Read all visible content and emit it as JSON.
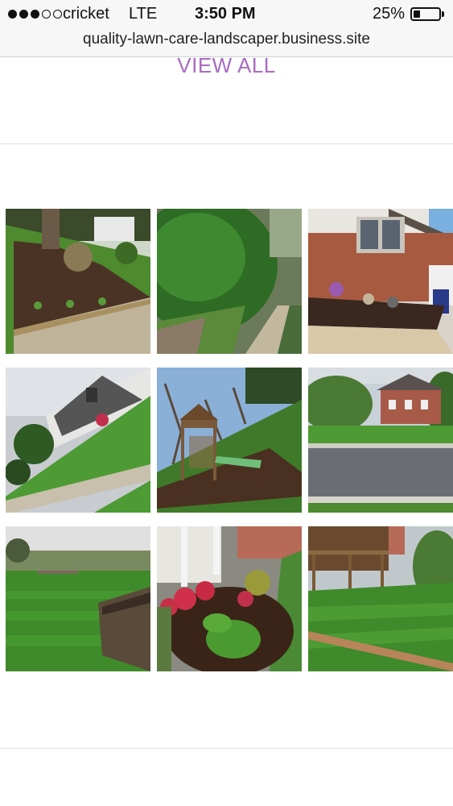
{
  "status_bar": {
    "carrier": "cricket",
    "network": "LTE",
    "time": "3:50 PM",
    "battery_percent": "25%",
    "battery_level": 0.25,
    "signal_bars_filled": 3,
    "signal_bars_total": 5
  },
  "browser": {
    "url": "quality-lawn-care-landscaper.business.site"
  },
  "section": {
    "view_all_label": "VIEW ALL",
    "link_color": "#a86cc1"
  },
  "gallery": {
    "photos": [
      {
        "subject": "mulched garden bed under tree"
      },
      {
        "subject": "tall green hedge along path"
      },
      {
        "subject": "brick house with mulch bed and flower pots"
      },
      {
        "subject": "sloped lawn by split-level house"
      },
      {
        "subject": "wooden playset with slide on mulch"
      },
      {
        "subject": "brick colonial house across street"
      },
      {
        "subject": "striped lawn with wooden fence"
      },
      {
        "subject": "landscaped flower bed by porch"
      },
      {
        "subject": "striped lawn beside wooden deck"
      }
    ]
  }
}
